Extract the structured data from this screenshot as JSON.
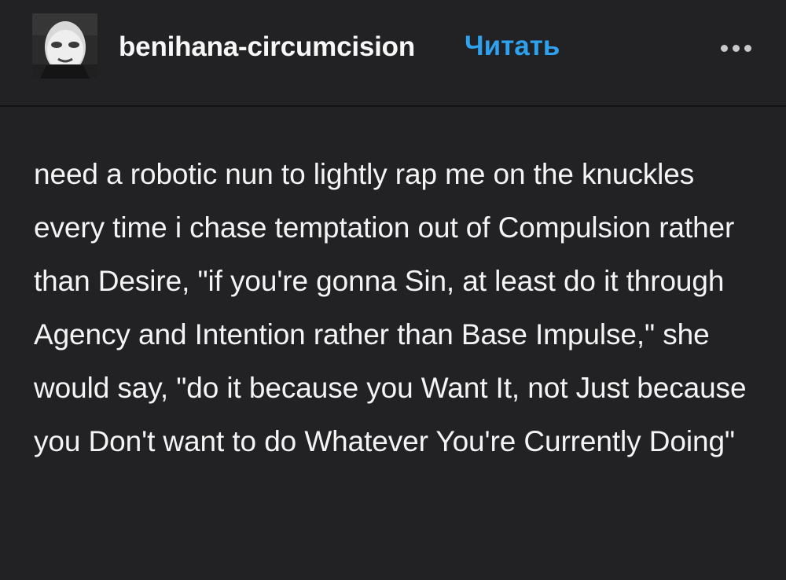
{
  "post": {
    "username": "benihana-circumcision",
    "follow_label": "Читать",
    "avatar_icon": "masked-face-avatar",
    "more_icon": "more-dots-icon",
    "body_text": "need a robotic nun to lightly rap me on the knuckles every time i chase temptation out of Compulsion rather than Desire, \"if you're gonna Sin, at least do it through Agency and Intention rather than Base Impulse,\" she would say, \"do it because you Want It, not Just because you Don't want to do Whatever You're Currently Doing\""
  },
  "colors": {
    "background": "#222225",
    "text": "#f4f4f4",
    "accent": "#2ea2ee",
    "divider": "#131314"
  }
}
